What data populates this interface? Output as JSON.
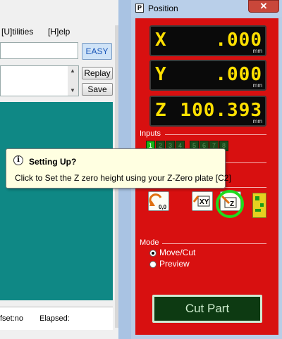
{
  "main_window": {
    "menu": {
      "utilities": "[U]tilities",
      "help": "[H]elp"
    },
    "easy_button": "EASY",
    "replay_button": "Replay",
    "save_button": "Save",
    "status": {
      "offset": "fset:no",
      "elapsed": "Elapsed:"
    }
  },
  "position_window": {
    "title": "Position",
    "title_icon": "P",
    "close_icon": "✕",
    "dro": [
      {
        "axis": "X",
        "value": ".000",
        "unit": "mm"
      },
      {
        "axis": "Y",
        "value": ".000",
        "unit": "mm"
      },
      {
        "axis": "Z",
        "value": "100.393",
        "unit": "mm"
      }
    ],
    "inputs_label": "Inputs",
    "inputs": [
      "1",
      "2",
      "3",
      "4",
      "5",
      "6",
      "7",
      "8"
    ],
    "input_active_index": 0,
    "mode_label": "Mode",
    "mode_options": [
      "Move/Cut",
      "Preview"
    ],
    "mode_selected": "Move/Cut",
    "cut_part_button": "Cut Part",
    "tool_buttons": [
      "zero-origin-icon",
      "xy-zero-icon",
      "z-zero-icon",
      "pcb-icon"
    ]
  },
  "tooltip": {
    "title": "Setting Up?",
    "body": "Click to Set the Z zero height using your Z-Zero plate [C2]",
    "icon": "info-icon"
  },
  "colors": {
    "panel_red": "#d81010",
    "dro_text": "#ffe000",
    "viewport_teal": "#0f8885",
    "highlight_green": "#1edc1e"
  }
}
